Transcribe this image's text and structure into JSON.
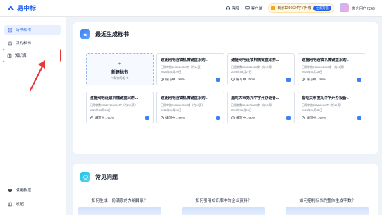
{
  "app": {
    "name": "易中标"
  },
  "topbar": {
    "service": "客服",
    "client": "客户端",
    "quota_text": "剩余1296624字 / 升级",
    "upgrade_label": "立即充值",
    "username": "微信用户2269"
  },
  "sidebar": {
    "items": [
      {
        "label": "标书写作",
        "icon": "document-edit-icon"
      },
      {
        "label": "我的标书",
        "icon": "folder-icon"
      },
      {
        "label": "知识库",
        "icon": "book-icon"
      }
    ],
    "bottom": [
      {
        "label": "使用教程",
        "icon": "help-icon"
      },
      {
        "label": "收起",
        "icon": "collapse-icon"
      }
    ]
  },
  "recent": {
    "title": "最近生成标书",
    "new_tile": {
      "plus": "+",
      "title": "新建标书",
      "subtitle": "AI帮你写标书"
    },
    "tiles": [
      {
        "title": "速捷网吧连锁机械键盘采购...",
        "quota": "已用字数3095/30000字（约10页）",
        "date": "2025年08月29日",
        "status": "编写中...90%"
      },
      {
        "title": "速捷网吧连锁机械键盘采购...",
        "quota": "已用字数2865/30000字（约10页）",
        "date": "2025年08月27日",
        "status": "编写中...90%"
      },
      {
        "title": "速捷网吧连锁机械键盘采购...",
        "quota": "已用字数19630/62400字（约40页）",
        "date": "2025年08月28日",
        "status": "编写中...90%"
      },
      {
        "title": "速捷网吧连锁机械键盘采购...",
        "quota": "已用字数33527/100000字（约200页）",
        "date": "2025年08月28日",
        "status": "编写中...90%"
      },
      {
        "title": "速捷网吧连锁机械键盘采购...",
        "quota": "已用字数2368/120000字（约20页）",
        "date": "2025年08月28日",
        "status": "编写中...90%"
      },
      {
        "title": "嘉峪关市第九中学开办设备...",
        "quota": "已用字数6001/76800字（约30页）",
        "date": "2025年08月26日",
        "status": "编写中...90%"
      },
      {
        "title": "嘉峪关市第九中学开办设备...",
        "quota": "已用字数450/60000字（约40页）",
        "date": "2025年08月25日",
        "status": "编写中...60%"
      }
    ]
  },
  "faq": {
    "title": "常见问题",
    "questions": [
      "如何生成一份满意的大纲目录？",
      "如何引用知识库中的企业资料？",
      "如何控制标书的整体生成字数？"
    ]
  },
  "colors": {
    "accent": "#2563eb",
    "highlight_box": "#e53935"
  }
}
